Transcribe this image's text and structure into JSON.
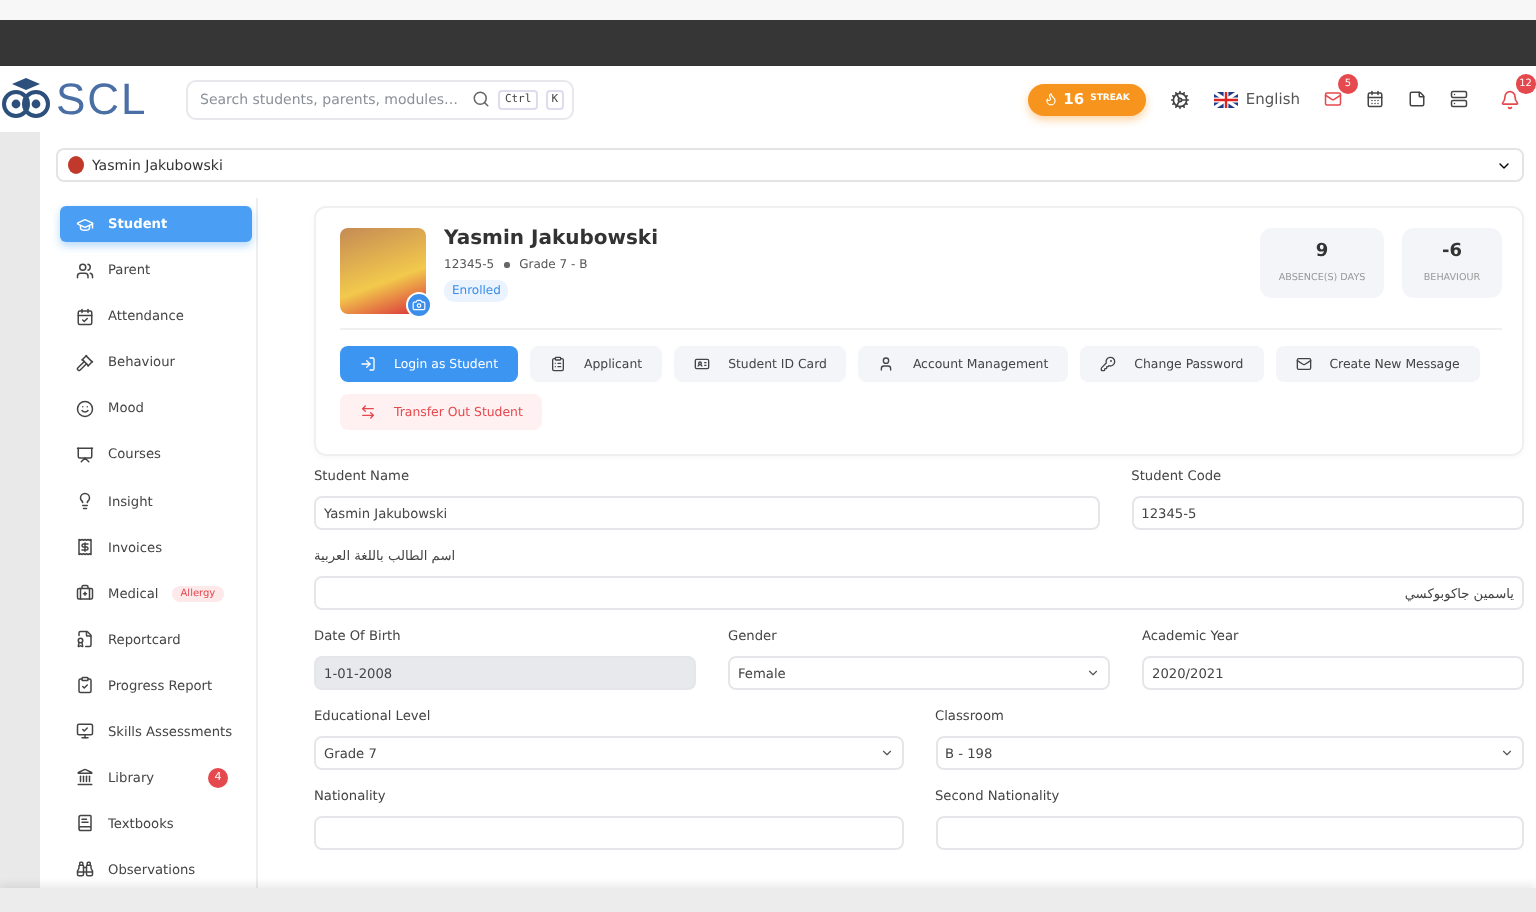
{
  "header": {
    "logo": "SCL",
    "search": {
      "placeholder": "Search students, parents, modules…",
      "keys": [
        "Ctrl",
        "K"
      ]
    },
    "streak": {
      "count": "16",
      "label": "STREAK"
    },
    "language": "English",
    "mail_badge": "5",
    "notification_badge": "12"
  },
  "student_select": {
    "value": "Yasmin Jakubowski"
  },
  "sidebar": {
    "items": [
      {
        "label": "Student",
        "selected": true
      },
      {
        "label": "Parent",
        "selected": false
      },
      {
        "label": "Attendance",
        "selected": false
      },
      {
        "label": "Behaviour",
        "selected": false
      },
      {
        "label": "Mood",
        "selected": false
      },
      {
        "label": "Courses",
        "selected": false
      },
      {
        "label": "Insight",
        "selected": false
      },
      {
        "label": "Invoices",
        "selected": false
      },
      {
        "label": "Medical",
        "selected": false,
        "tag": "Allergy"
      },
      {
        "label": "Reportcard",
        "selected": false
      },
      {
        "label": "Progress Report",
        "selected": false
      },
      {
        "label": "Skills Assessments",
        "selected": false
      },
      {
        "label": "Library",
        "selected": false,
        "badge": "4"
      },
      {
        "label": "Textbooks",
        "selected": false
      },
      {
        "label": "Observations",
        "selected": false
      }
    ]
  },
  "profile": {
    "name": "Yasmin Jakubowski",
    "code": "12345-5",
    "class": "Grade 7 - B",
    "status": "Enrolled",
    "stats": [
      {
        "value": "9",
        "label": "ABSENCE(S) DAYS"
      },
      {
        "value": "-6",
        "label": "BEHAVIOUR"
      }
    ],
    "actions": [
      {
        "label": "Login as Student",
        "kind": "primary"
      },
      {
        "label": "Applicant",
        "kind": "default"
      },
      {
        "label": "Student ID Card",
        "kind": "default"
      },
      {
        "label": "Account Management",
        "kind": "default"
      },
      {
        "label": "Change Password",
        "kind": "default"
      },
      {
        "label": "Create New Message",
        "kind": "default"
      },
      {
        "label": "Transfer Out Student",
        "kind": "danger"
      }
    ]
  },
  "form": {
    "rows": [
      {
        "fields": [
          {
            "label": "Student Name",
            "value": "Yasmin Jakubowski",
            "kind": "text"
          },
          {
            "label": "Student Code",
            "value": "12345-5",
            "kind": "text"
          }
        ]
      },
      {
        "fields": [
          {
            "label": "اسم الطالب باللغة العربية",
            "value": "ياسمين جاكوبوكسي",
            "kind": "text"
          }
        ]
      },
      {
        "fields": [
          {
            "label": "Date Of Birth",
            "value": "1-01-2008",
            "kind": "readonly"
          },
          {
            "label": "Gender",
            "value": "Female",
            "kind": "select"
          },
          {
            "label": "Academic Year",
            "value": "2020/2021",
            "kind": "text"
          }
        ]
      },
      {
        "fields": [
          {
            "label": "Educational Level",
            "value": "Grade 7",
            "kind": "select"
          },
          {
            "label": "Classroom",
            "value": "B - 198",
            "kind": "select"
          }
        ]
      },
      {
        "fields": [
          {
            "label": "Nationality",
            "kind": "text"
          },
          {
            "label": "Second Nationality",
            "kind": "text"
          }
        ]
      }
    ]
  }
}
